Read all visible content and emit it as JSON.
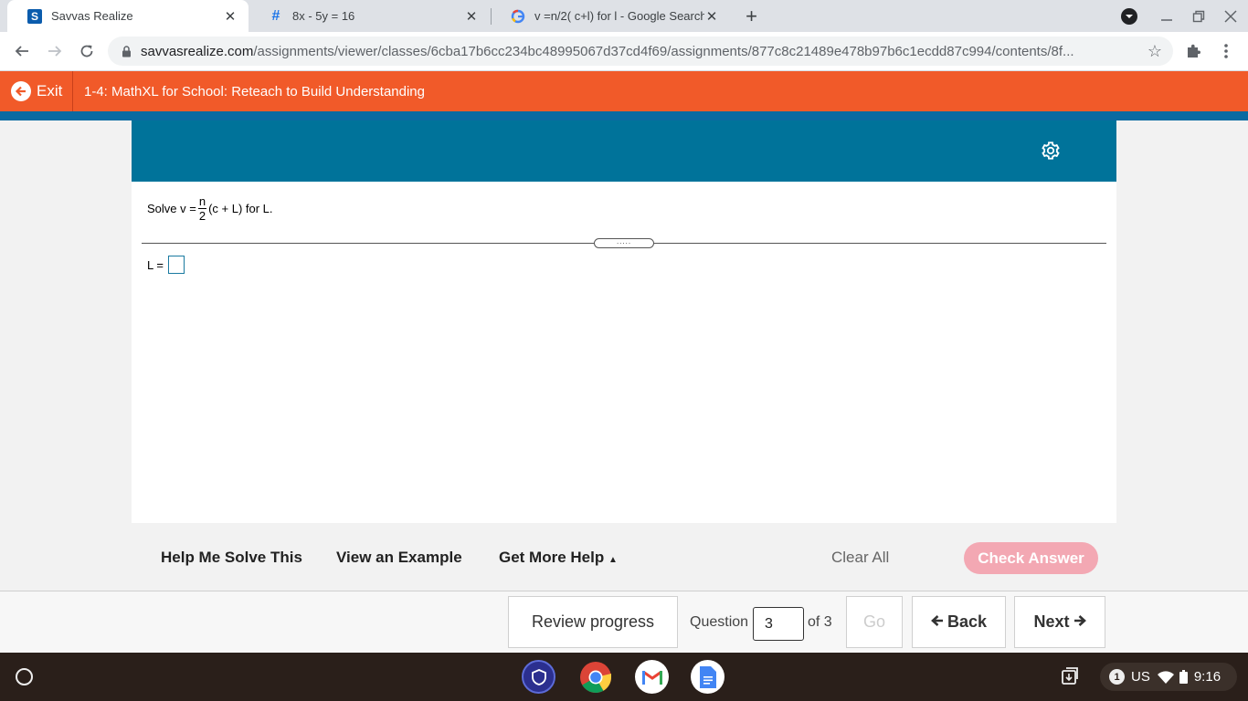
{
  "browser": {
    "tabs": [
      {
        "title": "Savvas Realize",
        "icon": "savvas-favicon",
        "active": true
      },
      {
        "title": "8x - 5y = 16",
        "icon": "hashtag-favicon",
        "active": false
      },
      {
        "title": "v =n/2( c+l) for l - Google Search",
        "icon": "google-favicon",
        "active": false
      }
    ],
    "url_host": "savvasrealize.com",
    "url_path": "/assignments/viewer/classes/6cba17b6cc234bc48995067d37cd4f69/assignments/877c8c21489e478b97b6c1ecdd87c994/contents/8f..."
  },
  "app": {
    "exit_label": "Exit",
    "assignment_title": "1-4: MathXL for School: Reteach to Build Understanding",
    "accent_color": "#f15a29",
    "header_color": "#00739a"
  },
  "question": {
    "prefix": "Solve v =",
    "frac_num": "n",
    "frac_den": "2",
    "suffix": "(c + L) for L.",
    "answer_label": "L =",
    "handle_dots": "....."
  },
  "help": {
    "help_me_solve": "Help Me Solve This",
    "view_example": "View an Example",
    "get_more_help": "Get More Help",
    "clear_all": "Clear All",
    "check_answer": "Check Answer"
  },
  "nav": {
    "review_progress": "Review progress",
    "question_label": "Question",
    "question_value": "3",
    "of_label": "of 3",
    "go_label": "Go",
    "back_label": "Back",
    "next_label": "Next"
  },
  "shelf": {
    "apps": [
      "security-app-icon",
      "chrome-app-icon",
      "gmail-app-icon",
      "docs-app-icon"
    ],
    "notification_count": "1",
    "keyboard_layout": "US",
    "time": "9:16"
  }
}
